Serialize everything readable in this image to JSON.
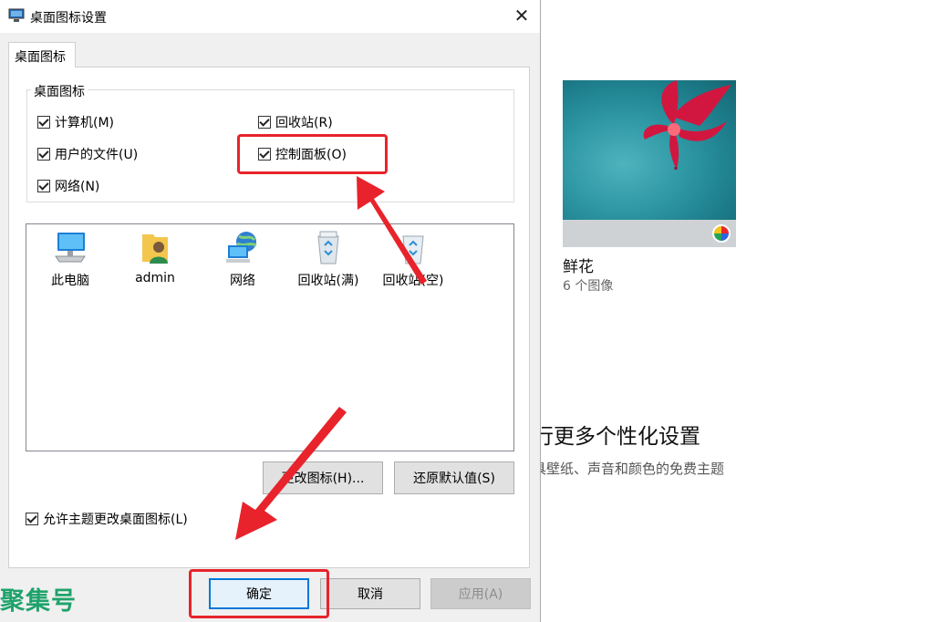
{
  "background": {
    "theme_name": "鲜花",
    "theme_count": "6 个图像",
    "more_title": "行更多个性化设置",
    "more_subtitle": "具壁纸、声音和颜色的免费主题"
  },
  "dialog": {
    "title": "桌面图标设置",
    "close_glyph": "✕",
    "tab_label": "桌面图标",
    "group_label": "桌面图标",
    "checkboxes": [
      {
        "label": "计算机(M)",
        "checked": true
      },
      {
        "label": "回收站(R)",
        "checked": true
      },
      {
        "label": "用户的文件(U)",
        "checked": true
      },
      {
        "label": "控制面板(O)",
        "checked": true
      },
      {
        "label": "网络(N)",
        "checked": true
      }
    ],
    "icons": [
      {
        "label": "此电脑",
        "icon": "computer-icon"
      },
      {
        "label": "admin",
        "icon": "user-folder-icon"
      },
      {
        "label": "网络",
        "icon": "network-icon"
      },
      {
        "label": "回收站(满)",
        "icon": "recycle-bin-full-icon"
      },
      {
        "label": "回收站(空)",
        "icon": "recycle-bin-empty-icon"
      }
    ],
    "change_icon_button": "更改图标(H)...",
    "restore_default_button": "还原默认值(S)",
    "allow_themes_label": "允许主题更改桌面图标(L)",
    "allow_themes_checked": true,
    "ok_button": "确定",
    "cancel_button": "取消",
    "apply_button": "应用(A)"
  },
  "watermark": "聚集号",
  "colors": {
    "highlight": "#e8232b",
    "accent": "#0078d7",
    "watermark": "#1fa36b"
  }
}
